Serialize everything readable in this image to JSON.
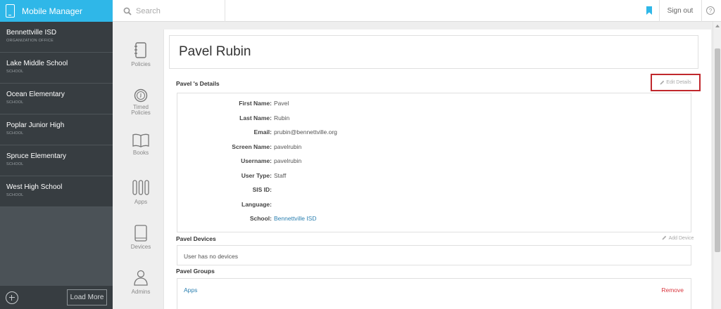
{
  "app": {
    "title": "Mobile Manager"
  },
  "header": {
    "search_placeholder": "Search",
    "sign_out": "Sign out",
    "help_glyph": "?",
    "accent_color": "#2fb7e8"
  },
  "sidebar": {
    "items": [
      {
        "name": "Bennettville ISD",
        "type": "ORGANIZATION OFFICE"
      },
      {
        "name": "Lake Middle School",
        "type": "SCHOOL"
      },
      {
        "name": "Ocean Elementary",
        "type": "SCHOOL"
      },
      {
        "name": "Poplar Junior High",
        "type": "SCHOOL"
      },
      {
        "name": "Spruce Elementary",
        "type": "SCHOOL"
      },
      {
        "name": "West High School",
        "type": "SCHOOL"
      }
    ],
    "load_more": "Load More"
  },
  "rail": {
    "items": [
      {
        "label": "Policies",
        "icon": "policies-icon"
      },
      {
        "label": "Timed Policies",
        "icon": "timer-icon"
      },
      {
        "label": "Books",
        "icon": "book-icon"
      },
      {
        "label": "Apps",
        "icon": "apps-icon"
      },
      {
        "label": "Devices",
        "icon": "tablet-icon"
      },
      {
        "label": "Admins",
        "icon": "user-icon"
      }
    ]
  },
  "main": {
    "user_name": "Pavel Rubin",
    "details_title": "Pavel 's Details",
    "edit_details": "Edit Details",
    "details": [
      {
        "label": "First Name:",
        "value": "Pavel"
      },
      {
        "label": "Last Name:",
        "value": "Rubin"
      },
      {
        "label": "Email:",
        "value": "prubin@bennettville.org"
      },
      {
        "label": "Screen Name:",
        "value": "pavelrubin"
      },
      {
        "label": "Username:",
        "value": "pavelrubin"
      },
      {
        "label": "User Type:",
        "value": "Staff"
      },
      {
        "label": "SIS ID:",
        "value": ""
      },
      {
        "label": "Language:",
        "value": ""
      },
      {
        "label": "School:",
        "value": "Bennettville ISD"
      }
    ],
    "devices_title": "Pavel Devices",
    "add_device": "Add Device",
    "no_devices": "User has no devices",
    "groups_title": "Pavel Groups",
    "groups": [
      {
        "name": "Apps",
        "action": "Remove"
      }
    ],
    "remove_color": "#d9363e",
    "highlight_color": "#c0282d"
  }
}
